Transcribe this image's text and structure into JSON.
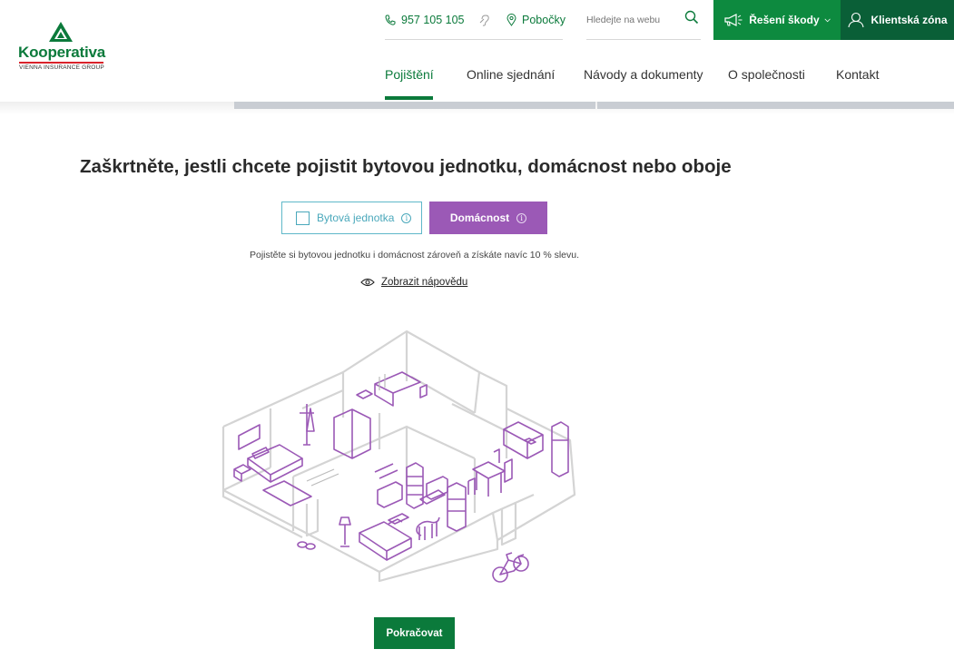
{
  "brand": {
    "name": "Kooperativa",
    "subtitle": "VIENNA INSURANCE GROUP",
    "colors": {
      "green": "#0b7a3b",
      "dark_green": "#0a5f37",
      "purple": "#9b59b6",
      "teal": "#4aa8bb",
      "red": "#d9222a"
    }
  },
  "utility": {
    "phone": "957 105 105",
    "branches": "Pobočky",
    "search_placeholder": "Hledejte na webu",
    "claims_button": "Řešení škody",
    "client_zone": "Klientská zóna"
  },
  "nav": {
    "items": [
      {
        "label": "Pojištění",
        "active": true
      },
      {
        "label": "Online sjednání",
        "active": false
      },
      {
        "label": "Návody a dokumenty",
        "active": false
      },
      {
        "label": "O společnosti",
        "active": false
      },
      {
        "label": "Kontakt",
        "active": false
      }
    ]
  },
  "form": {
    "heading": "Zaškrtněte, jestli chcete pojistit bytovou jednotku, domácnost nebo oboje",
    "options": [
      {
        "label": "Bytová jednotka",
        "selected": false
      },
      {
        "label": "Domácnost",
        "selected": true
      }
    ],
    "hint": "Pojistěte si bytovou jednotku i domácnost zároveň a získáte navíc 10 % slevu.",
    "help_link": "Zobrazit nápovědu",
    "continue_button": "Pokračovat"
  },
  "icons": [
    "phone-icon",
    "ear-icon",
    "location-pin-icon",
    "search-icon",
    "megaphone-icon",
    "user-icon",
    "info-icon",
    "eye-icon"
  ]
}
